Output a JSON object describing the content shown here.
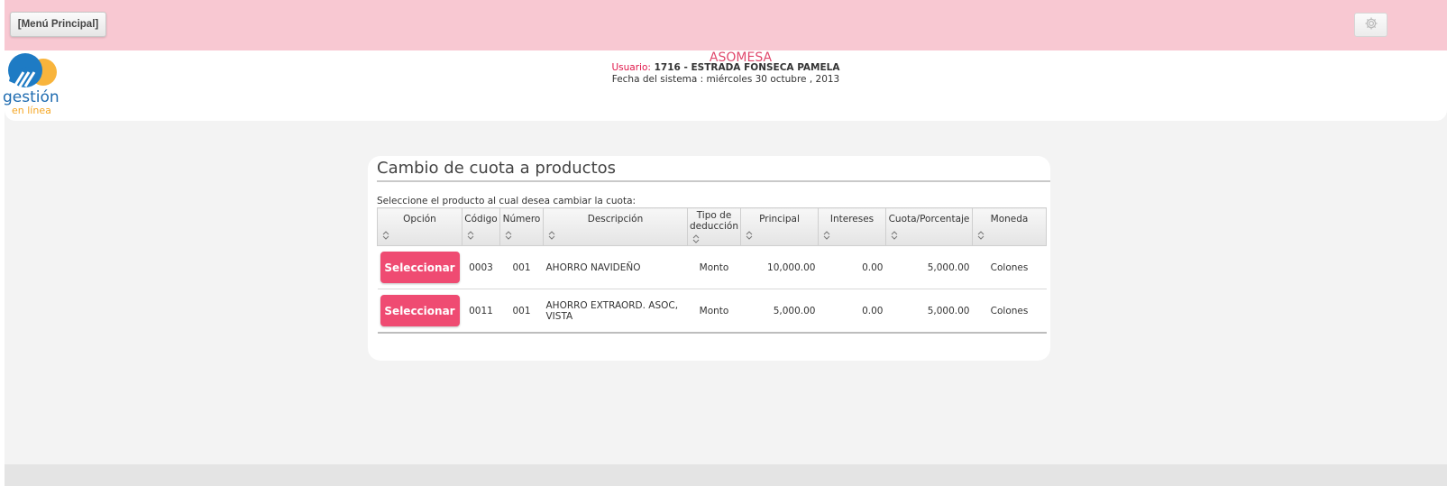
{
  "topbar": {
    "menu_label": "[Menú Principal]",
    "settings_icon": "gear-icon"
  },
  "header": {
    "logo_text_main": "gestión",
    "logo_text_sub": "en línea",
    "brand": "ASOMESA",
    "user_label": "Usuario:",
    "user_value": "1716 - ESTRADA FONSECA PAMELA",
    "date_text": "Fecha del sistema : miércoles 30 octubre , 2013",
    "colors": {
      "brand": "#e0486c",
      "topbar": "#f8c8d2",
      "accent_button": "#ef4b72"
    }
  },
  "panel": {
    "title": "Cambio de cuota a productos",
    "instruction": "Seleccione el producto al cual desea cambiar la cuota:",
    "columns": [
      "Opción",
      "Código",
      "Número",
      "Descripción",
      "Tipo de deducción",
      "Principal",
      "Intereses",
      "Cuota/Porcentaje",
      "Moneda"
    ],
    "rows": [
      {
        "action": "Seleccionar",
        "codigo": "0003",
        "numero": "001",
        "descripcion": "AHORRO NAVIDEÑO",
        "tipo": "Monto",
        "principal": "10,000.00",
        "intereses": "0.00",
        "cuota": "5,000.00",
        "moneda": "Colones"
      },
      {
        "action": "Seleccionar",
        "codigo": "0011",
        "numero": "001",
        "descripcion": "AHORRO EXTRAORD. ASOC, VISTA",
        "tipo": "Monto",
        "principal": "5,000.00",
        "intereses": "0.00",
        "cuota": "5,000.00",
        "moneda": "Colones"
      }
    ]
  }
}
